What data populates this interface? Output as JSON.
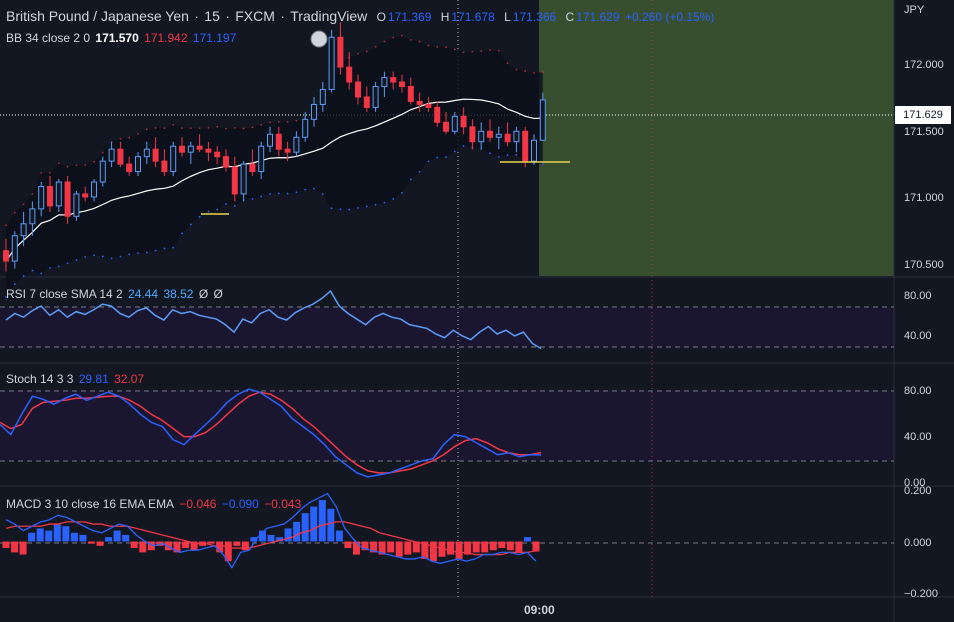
{
  "header": {
    "symbol": "British Pound / Japanese Yen",
    "interval": "15",
    "exchange": "FXCM",
    "brand": "TradingView",
    "ohlc": {
      "o_label": "O",
      "o_value": "171.369",
      "h_label": "H",
      "h_value": "171.678",
      "l_label": "L",
      "l_value": "171.366",
      "c_label": "C",
      "c_value": "171.629",
      "change": "+0.260 (+0.15%)"
    }
  },
  "indicators": {
    "bb": {
      "label": "BB 34 close 2 0",
      "basis": "171.570",
      "upper": "171.942",
      "lower": "171.197"
    },
    "rsi": {
      "label": "RSI 7 close SMA 14 2",
      "v1": "24.44",
      "v2": "38.52",
      "v3": "Ø",
      "v4": "Ø"
    },
    "stoch": {
      "label": "Stoch 14 3 3",
      "k": "29.81",
      "d": "32.07"
    },
    "macd": {
      "label": "MACD 3 10 close 16 EMA EMA",
      "hist": "−0.046",
      "macd": "−0.090",
      "signal": "−0.043"
    }
  },
  "price_axis": {
    "currency": "JPY",
    "ticks": [
      "172.000",
      "171.500",
      "171.000",
      "170.500"
    ],
    "last_price": "171.629"
  },
  "rsi_axis": {
    "ticks": [
      "80.00",
      "40.00"
    ]
  },
  "stoch_axis": {
    "ticks": [
      "80.00",
      "40.00",
      "0.00"
    ]
  },
  "macd_axis": {
    "ticks": [
      "0.200",
      "0.000",
      "−0.200"
    ]
  },
  "time_axis": {
    "label": "09:00"
  },
  "colors": {
    "up": "#5b9cf6",
    "down": "#f23645",
    "bb_band": "#f23645",
    "bb_lower": "#2962ff",
    "basis": "#ffffff",
    "zone": "#374f2f"
  },
  "chart_data": {
    "type": "candlestick",
    "price_range": [
      170.45,
      172.3
    ],
    "candles": [
      [
        170.62,
        170.7,
        170.48,
        170.55
      ],
      [
        170.55,
        170.75,
        170.5,
        170.72
      ],
      [
        170.72,
        170.88,
        170.65,
        170.8
      ],
      [
        170.8,
        170.95,
        170.72,
        170.9
      ],
      [
        170.9,
        171.08,
        170.85,
        171.05
      ],
      [
        171.05,
        171.12,
        170.88,
        170.92
      ],
      [
        170.92,
        171.1,
        170.88,
        171.08
      ],
      [
        171.08,
        171.12,
        170.8,
        170.85
      ],
      [
        170.85,
        171.02,
        170.82,
        171.0
      ],
      [
        171.0,
        171.05,
        170.95,
        170.98
      ],
      [
        170.98,
        171.1,
        170.95,
        171.08
      ],
      [
        171.08,
        171.25,
        171.05,
        171.22
      ],
      [
        171.22,
        171.35,
        171.18,
        171.3
      ],
      [
        171.3,
        171.35,
        171.18,
        171.2
      ],
      [
        171.2,
        171.25,
        171.12,
        171.15
      ],
      [
        171.15,
        171.28,
        171.12,
        171.25
      ],
      [
        171.25,
        171.35,
        171.2,
        171.3
      ],
      [
        171.3,
        171.38,
        171.18,
        171.22
      ],
      [
        171.22,
        171.3,
        171.12,
        171.15
      ],
      [
        171.15,
        171.35,
        171.12,
        171.32
      ],
      [
        171.32,
        171.38,
        171.25,
        171.28
      ],
      [
        171.28,
        171.35,
        171.2,
        171.32
      ],
      [
        171.32,
        171.4,
        171.28,
        171.3
      ],
      [
        171.3,
        171.35,
        171.22,
        171.28
      ],
      [
        171.28,
        171.32,
        171.2,
        171.25
      ],
      [
        171.25,
        171.3,
        171.15,
        171.18
      ],
      [
        171.18,
        171.25,
        170.95,
        171.0
      ],
      [
        171.0,
        171.22,
        170.95,
        171.2
      ],
      [
        171.2,
        171.3,
        171.12,
        171.15
      ],
      [
        171.15,
        171.35,
        171.1,
        171.32
      ],
      [
        171.32,
        171.45,
        171.28,
        171.4
      ],
      [
        171.4,
        171.45,
        171.25,
        171.3
      ],
      [
        171.3,
        171.35,
        171.22,
        171.28
      ],
      [
        171.28,
        171.42,
        171.25,
        171.38
      ],
      [
        171.38,
        171.55,
        171.35,
        171.5
      ],
      [
        171.5,
        171.65,
        171.45,
        171.6
      ],
      [
        171.6,
        171.75,
        171.55,
        171.7
      ],
      [
        171.7,
        172.1,
        171.68,
        172.05
      ],
      [
        172.05,
        172.15,
        171.8,
        171.85
      ],
      [
        171.85,
        171.95,
        171.7,
        171.75
      ],
      [
        171.75,
        171.8,
        171.6,
        171.65
      ],
      [
        171.65,
        171.72,
        171.55,
        171.58
      ],
      [
        171.58,
        171.75,
        171.55,
        171.72
      ],
      [
        171.72,
        171.82,
        171.65,
        171.78
      ],
      [
        171.78,
        171.82,
        171.7,
        171.75
      ],
      [
        171.75,
        171.8,
        171.68,
        171.72
      ],
      [
        171.72,
        171.78,
        171.6,
        171.62
      ],
      [
        171.62,
        171.68,
        171.55,
        171.6
      ],
      [
        171.6,
        171.65,
        171.55,
        171.58
      ],
      [
        171.58,
        171.62,
        171.45,
        171.48
      ],
      [
        171.48,
        171.55,
        171.4,
        171.42
      ],
      [
        171.42,
        171.55,
        171.4,
        171.52
      ],
      [
        171.52,
        171.58,
        171.4,
        171.45
      ],
      [
        171.45,
        171.5,
        171.3,
        171.35
      ],
      [
        171.35,
        171.48,
        171.3,
        171.42
      ],
      [
        171.42,
        171.5,
        171.35,
        171.38
      ],
      [
        171.38,
        171.45,
        171.3,
        171.4
      ],
      [
        171.4,
        171.48,
        171.32,
        171.35
      ],
      [
        171.35,
        171.45,
        171.28,
        171.42
      ],
      [
        171.42,
        171.45,
        171.18,
        171.22
      ],
      [
        171.22,
        171.4,
        171.2,
        171.36
      ],
      [
        171.36,
        171.68,
        171.36,
        171.63
      ]
    ],
    "rsi_range": [
      10,
      100
    ],
    "rsi": [
      55,
      62,
      58,
      65,
      70,
      60,
      66,
      58,
      64,
      61,
      66,
      72,
      70,
      62,
      58,
      65,
      68,
      60,
      55,
      66,
      62,
      64,
      60,
      58,
      56,
      50,
      42,
      56,
      52,
      62,
      66,
      58,
      55,
      63,
      68,
      72,
      78,
      86,
      70,
      62,
      56,
      50,
      58,
      62,
      58,
      56,
      50,
      48,
      46,
      40,
      36,
      44,
      38,
      34,
      42,
      48,
      40,
      44,
      38,
      42,
      30,
      24.44
    ],
    "rsi_ma": [
      60,
      61,
      61,
      62,
      63,
      62,
      62,
      62,
      62,
      62,
      63,
      64,
      64,
      63,
      63,
      63,
      63,
      62,
      62,
      62,
      62,
      62,
      62,
      61,
      60,
      59,
      58,
      57,
      57,
      57,
      58,
      58,
      58,
      58,
      59,
      60,
      62,
      64,
      64,
      63,
      62,
      61,
      60,
      59,
      58,
      57,
      56,
      55,
      54,
      52,
      50,
      48,
      47,
      46,
      45,
      44,
      43,
      42,
      41,
      40,
      39,
      38.52
    ],
    "stoch_range": [
      0,
      120
    ],
    "stoch_k": [
      60,
      50,
      70,
      88,
      85,
      80,
      86,
      90,
      84,
      88,
      92,
      88,
      80,
      70,
      62,
      58,
      45,
      40,
      50,
      60,
      70,
      82,
      90,
      95,
      92,
      85,
      78,
      66,
      58,
      50,
      40,
      28,
      20,
      12,
      8,
      10,
      12,
      16,
      20,
      24,
      26,
      40,
      50,
      48,
      42,
      36,
      30,
      32,
      28,
      30,
      29.81
    ],
    "stoch_d": [
      62,
      56,
      60,
      76,
      82,
      83,
      84,
      86,
      86,
      87,
      88,
      88,
      84,
      78,
      70,
      64,
      56,
      48,
      48,
      52,
      60,
      70,
      80,
      88,
      92,
      90,
      84,
      76,
      66,
      58,
      48,
      38,
      28,
      20,
      14,
      12,
      12,
      14,
      16,
      20,
      24,
      30,
      38,
      44,
      46,
      42,
      36,
      32,
      30,
      30,
      32.07
    ],
    "macd_range": [
      -0.25,
      0.25
    ],
    "macd_hist": [
      -0.03,
      -0.05,
      -0.06,
      0.04,
      0.06,
      0.05,
      0.08,
      0.07,
      0.04,
      0.03,
      -0.01,
      -0.02,
      0.02,
      0.05,
      0.03,
      -0.03,
      -0.05,
      -0.04,
      -0.02,
      -0.04,
      -0.05,
      -0.03,
      -0.04,
      -0.02,
      -0.01,
      -0.05,
      -0.09,
      -0.02,
      -0.04,
      0.02,
      0.05,
      0.03,
      0.02,
      0.06,
      0.09,
      0.13,
      0.16,
      0.19,
      0.15,
      0.05,
      -0.03,
      -0.06,
      -0.04,
      -0.05,
      -0.06,
      -0.05,
      -0.07,
      -0.06,
      -0.05,
      -0.08,
      -0.09,
      -0.07,
      -0.06,
      -0.08,
      -0.06,
      -0.05,
      -0.05,
      -0.04,
      -0.03,
      -0.04,
      -0.05,
      0.02,
      -0.046
    ],
    "macd_line": [
      0.1,
      0.08,
      0.05,
      0.07,
      0.09,
      0.1,
      0.12,
      0.11,
      0.09,
      0.07,
      0.05,
      0.04,
      0.06,
      0.08,
      0.07,
      0.03,
      0.0,
      -0.02,
      -0.01,
      -0.03,
      -0.05,
      -0.04,
      -0.04,
      -0.03,
      -0.02,
      -0.06,
      -0.12,
      -0.05,
      -0.04,
      0.02,
      0.06,
      0.07,
      0.08,
      0.11,
      0.15,
      0.18,
      0.2,
      0.22,
      0.16,
      0.06,
      0.01,
      -0.03,
      -0.04,
      -0.05,
      -0.06,
      -0.07,
      -0.08,
      -0.08,
      -0.07,
      -0.09,
      -0.1,
      -0.09,
      -0.08,
      -0.09,
      -0.08,
      -0.06,
      -0.06,
      -0.05,
      -0.05,
      -0.06,
      -0.05,
      -0.09
    ],
    "macd_signal": [
      0.06,
      0.07,
      0.07,
      0.07,
      0.07,
      0.08,
      0.08,
      0.09,
      0.09,
      0.09,
      0.08,
      0.08,
      0.07,
      0.07,
      0.07,
      0.06,
      0.05,
      0.04,
      0.03,
      0.02,
      0.01,
      0.0,
      -0.01,
      -0.01,
      -0.02,
      -0.02,
      -0.03,
      -0.03,
      -0.03,
      -0.02,
      -0.01,
      0.0,
      0.01,
      0.02,
      0.04,
      0.05,
      0.07,
      0.08,
      0.09,
      0.09,
      0.08,
      0.07,
      0.06,
      0.04,
      0.03,
      0.02,
      0.01,
      0.0,
      -0.01,
      -0.02,
      -0.03,
      -0.04,
      -0.05,
      -0.05,
      -0.06,
      -0.06,
      -0.06,
      -0.06,
      -0.05,
      -0.05,
      -0.05,
      -0.043
    ]
  }
}
